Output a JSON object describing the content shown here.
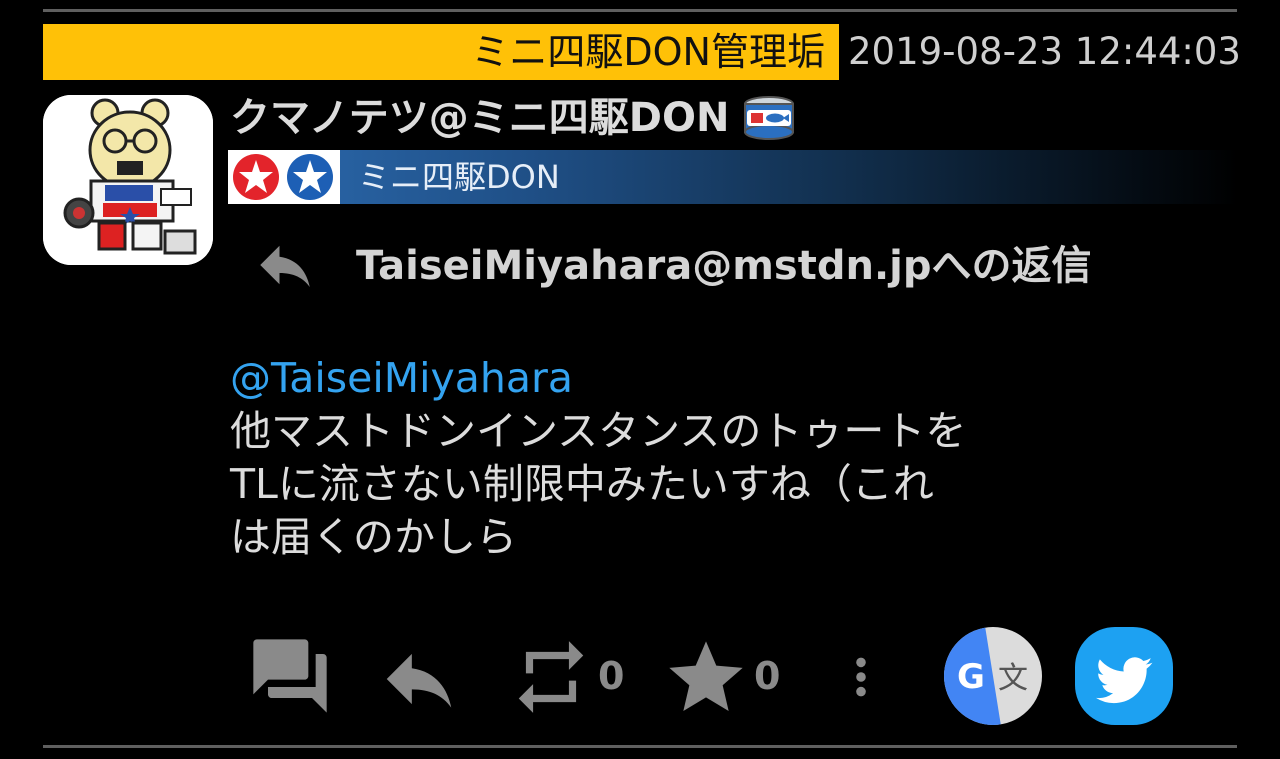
{
  "boost": {
    "label": "ミニ四駆DON管理垢"
  },
  "status": {
    "timestamp": "2019-08-23 12:44:03",
    "display_name": "クマノテツ@ミニ四駆DON",
    "instance_name": "ミニ四駆DON",
    "reply_to": "TaiseiMiyahara@mstdn.jpへの返信",
    "mention": "@TaiseiMiyahara",
    "content_lines": [
      "他マストドンインスタンスのトゥートを",
      "TLに流さない制限中みたいすね（これ",
      "は届くのかしら"
    ]
  },
  "actions": {
    "reblog_count": "0",
    "favourite_count": "0"
  },
  "icons": {
    "conversation": "conversation-icon",
    "reply": "reply-icon",
    "reblog": "reblog-icon",
    "favourite": "star-icon",
    "more": "more-vert-icon",
    "translate": "google-translate-icon",
    "share": "twitter-icon",
    "custom_emoji": "saba-can-emoji"
  },
  "colors": {
    "background": "#000000",
    "boost_banner": "#ffc107",
    "mention": "#34a3f0",
    "action_icon": "#8a8a8a",
    "twitter": "#1da1f2",
    "translate_blue": "#4285f4"
  }
}
